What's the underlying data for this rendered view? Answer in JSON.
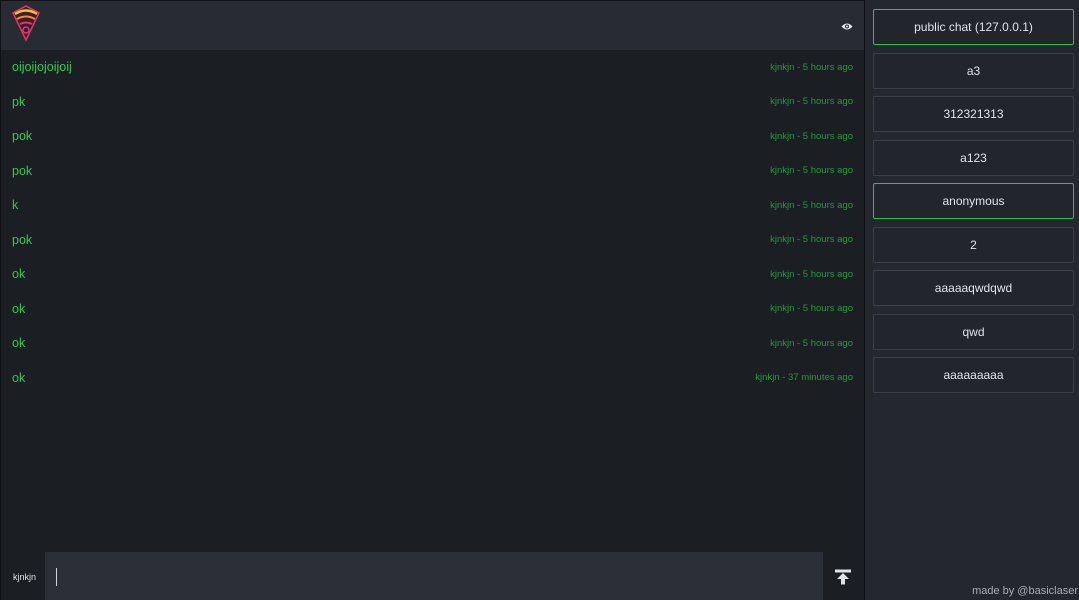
{
  "header": {
    "toggle_icon": "eye-icon"
  },
  "messages": [
    {
      "text": "oijoijojoijoij",
      "meta": "kjnkjn - 5 hours ago"
    },
    {
      "text": "pk",
      "meta": "kjnkjn - 5 hours ago"
    },
    {
      "text": "pok",
      "meta": "kjnkjn - 5 hours ago"
    },
    {
      "text": "pok",
      "meta": "kjnkjn - 5 hours ago"
    },
    {
      "text": "k",
      "meta": "kjnkjn - 5 hours ago"
    },
    {
      "text": "pok",
      "meta": "kjnkjn - 5 hours ago"
    },
    {
      "text": "ok",
      "meta": "kjnkjn - 5 hours ago"
    },
    {
      "text": "ok",
      "meta": "kjnkjn - 5 hours ago"
    },
    {
      "text": "ok",
      "meta": "kjnkjn - 5 hours ago"
    },
    {
      "text": "ok",
      "meta": "kjnkjn - 37 minutes ago"
    }
  ],
  "composer": {
    "username": "kjnkjn",
    "value": "",
    "send_icon": "send-icon"
  },
  "rooms": [
    {
      "label": "public chat (127.0.0.1)",
      "active": true
    },
    {
      "label": "a3",
      "active": false
    },
    {
      "label": "312321313",
      "active": false
    },
    {
      "label": "a123",
      "active": false
    },
    {
      "label": "anonymous",
      "active": true
    },
    {
      "label": "2",
      "active": false
    },
    {
      "label": "aaaaaqwdqwd",
      "active": false
    },
    {
      "label": "qwd",
      "active": false
    },
    {
      "label": "aaaaaaaaa",
      "active": false
    }
  ],
  "footer": {
    "credit": "made by @basiclaser"
  },
  "colors": {
    "message_text": "#2ecc52",
    "message_meta": "#1f9b3d",
    "active_border": "#27c24f"
  }
}
